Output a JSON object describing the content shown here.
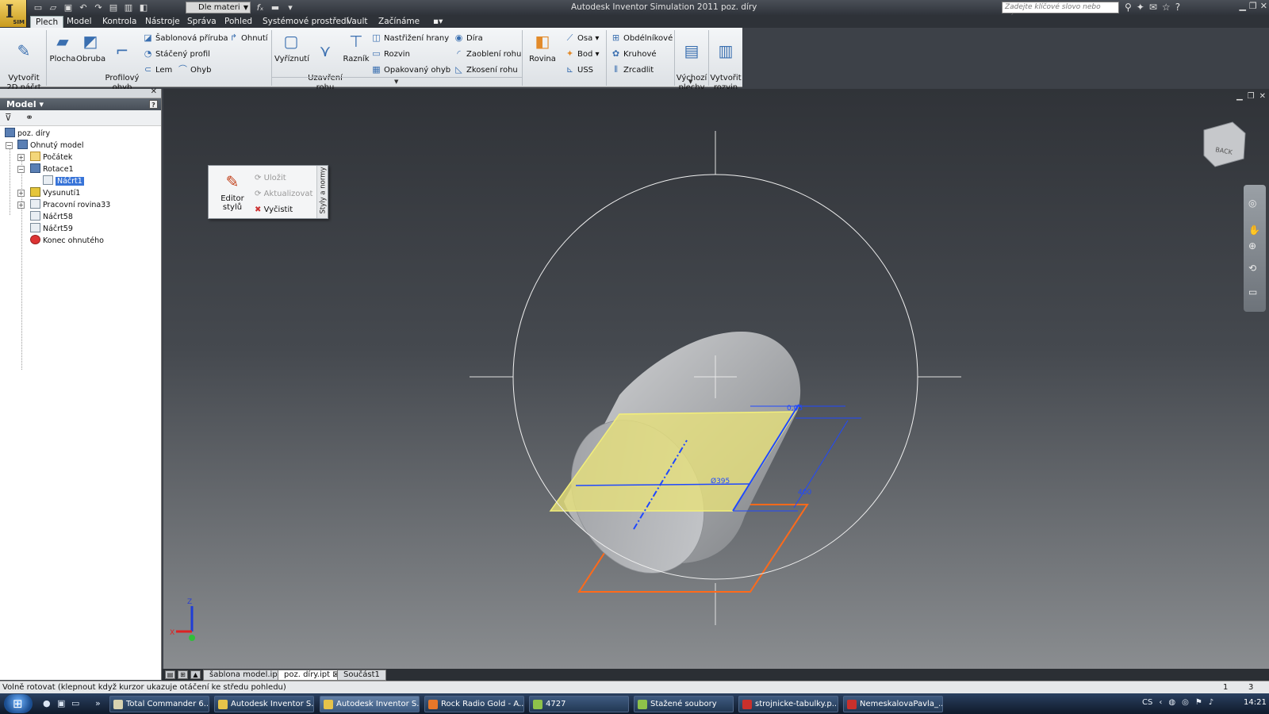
{
  "titlebar": {
    "logo_text": "I",
    "logo_sub": "SIM",
    "material_select": "Dle materi",
    "window_title": "Autodesk Inventor Simulation 2011    poz. díry",
    "search_placeholder": "Zadejte klíčové slovo nebo výraz."
  },
  "tabs": [
    {
      "label": "Plech",
      "active": true
    },
    {
      "label": "Model"
    },
    {
      "label": "Kontrola"
    },
    {
      "label": "Nástroje"
    },
    {
      "label": "Správa"
    },
    {
      "label": "Pohled"
    },
    {
      "label": "Systémové prostředí"
    },
    {
      "label": "Vault"
    },
    {
      "label": "Začínáme"
    }
  ],
  "ribbon": {
    "create_sketch": "Vytvořit\n2D náčrt",
    "face": "Plocha",
    "flange": "Obruba",
    "contour_flange": "Profilový\nohyb",
    "template_flange": "Šablonová příruba",
    "fold": "Ohnutí",
    "rolled_profile": "Stáčený profil",
    "hem": "Lem",
    "bend": "Ohyb",
    "cut": "Vyříznutí",
    "corner_seam": "Uzavření\nrohu",
    "punch": "Razník",
    "edge_cut": "Nastřižení hrany",
    "unfold": "Rozvin",
    "repeated_bend": "Opakovaný ohyb",
    "hole": "Díra",
    "corner_round": "Zaoblení rohu",
    "corner_chamfer": "Zkosení rohu",
    "plane": "Rovina",
    "axis": "Osa",
    "point": "Bod",
    "ucs": "USS",
    "rectangular": "Obdélníkové",
    "circular": "Kruhové",
    "mirror": "Zrcadlit",
    "default_sheets": "Výchozí\nplechy",
    "create_flat": "Vytvořit\nrozvin"
  },
  "browser": {
    "title": "Model",
    "help": "?",
    "tree": [
      {
        "label": "poz. díry",
        "level": 0,
        "icon": "part"
      },
      {
        "label": "Ohnutý model",
        "level": 1,
        "icon": "part"
      },
      {
        "label": "Počátek",
        "level": 2,
        "icon": "folder"
      },
      {
        "label": "Rotace1",
        "level": 2,
        "icon": "blue"
      },
      {
        "label": "Náčrt1",
        "level": 3,
        "icon": "sketch",
        "selected": true
      },
      {
        "label": "Vysunutí1",
        "level": 2,
        "icon": "yel"
      },
      {
        "label": "Pracovní rovina33",
        "level": 2,
        "icon": "sketch"
      },
      {
        "label": "Náčrt58",
        "level": 2,
        "icon": "sketch"
      },
      {
        "label": "Náčrt59",
        "level": 2,
        "icon": "sketch"
      },
      {
        "label": "Konec ohnutého",
        "level": 2,
        "icon": "red"
      }
    ]
  },
  "style_popup": {
    "editor": "Editor stylů",
    "save": "Uložit",
    "update": "Aktualizovat",
    "purge": "Vyčistit",
    "vertical": "Styly a normy"
  },
  "viewport": {
    "viewcube_label": "BACK",
    "dim_005": "0,05",
    "dim_diameter": "Ø395",
    "dim_400": "400",
    "axis_x": "X",
    "axis_z": "Z",
    "colors": {
      "circle": "#ffffff",
      "cylinder": "#a5a7aa",
      "plane": "#e8e27a",
      "dims": "#1f48ff",
      "orange": "#ff6a1a"
    }
  },
  "doctabs": [
    "šablona model.ipt",
    "poz. díry.ipt",
    "Součást1"
  ],
  "status": {
    "text": "Volně rotovat (klepnout když kurzor ukazuje otáčení ke středu pohledu)",
    "n1": "1",
    "n2": "3"
  },
  "taskbar": {
    "items": [
      {
        "label": "Total Commander 6....",
        "color": "#d7d2b0"
      },
      {
        "label": "Autodesk Inventor S...",
        "color": "#e6c34a"
      },
      {
        "label": "Autodesk Inventor S...",
        "color": "#e6c34a",
        "active": true
      },
      {
        "label": "Rock Radio Gold - A...",
        "color": "#e7772a"
      },
      {
        "label": "4727",
        "color": "#8ec24a"
      },
      {
        "label": "Stažené soubory",
        "color": "#8ec24a"
      },
      {
        "label": "strojnicke-tabulky.p...",
        "color": "#c9302c"
      },
      {
        "label": "NemeskalovaPavla_...",
        "color": "#c9302c"
      }
    ],
    "lang": "CS",
    "clock": "14:21"
  }
}
